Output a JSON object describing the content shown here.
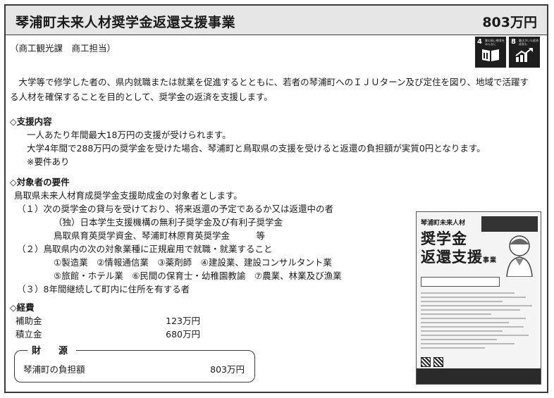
{
  "header": {
    "title": "琴浦町未来人材奨学金返還支援事業",
    "amount": "803万円"
  },
  "department": "（商工観光課　商工担当）",
  "sdgs": [
    {
      "num": "4",
      "caption": "質の高い教育をみんなに",
      "icon": "book-icon"
    },
    {
      "num": "8",
      "caption": "働きがいも経済成長も",
      "icon": "growth-chart-icon"
    }
  ],
  "intro": "大学等で修学した者の、県内就職または就業を促進するとともに、若者の琴浦町へのＩＪＵターン及び定住を図り、地域で活躍する人材を確保することを目的として、奨学金の返済を支援します。",
  "support": {
    "heading": "◇支援内容",
    "lines": [
      "一人あたり年間最大18万円の支援が受けられます。",
      "大学4年間で288万円の奨学金を受けた場合、琴浦町と鳥取県の支援を受けると返還の負担額が実質0円となります。",
      "※要件あり"
    ]
  },
  "eligibility": {
    "heading": "◇対象者の要件",
    "intro": "鳥取県未来人材育成奨学金支援助成金の対象者とします。",
    "item1": "（１）次の奨学金の貸与を受けており、将来返還の予定であるか又は返還中の者",
    "item1_sub1": "（独）日本学生支援機構の無利子奨学金及び有利子奨学金",
    "item1_sub2": "鳥取県育英奨学資金、琴浦町林原育英奨学金　　　等",
    "item2": "（２）鳥取県内の次の対象業種に正規雇用で就職・就業すること",
    "item2_sub1": "①製造業　②情報通信業　③薬剤師　④建設業、建設コンサルタント業",
    "item2_sub2": "⑤旅館・ホテル業　⑥民間の保育士・幼稚園教諭　⑦農業、林業及び漁業",
    "item3": "（３）8年間継続して町内に住所を有する者"
  },
  "expenses": {
    "heading": "◇経費",
    "rows": [
      {
        "label": "補助金",
        "value": "123万円"
      },
      {
        "label": "積立金",
        "value": "680万円"
      }
    ]
  },
  "funding": {
    "title": "財　源",
    "label": "琴浦町の負担額",
    "value": "803万円"
  },
  "leaflet": {
    "top": "琴浦町未来人材",
    "big1": "奨学金",
    "big2": "返還支援",
    "suffix": "事業"
  },
  "colors": {
    "header_bg": "#e6e6e6",
    "border": "#3a3a3a",
    "sdg_tile": "#1e1e1e"
  }
}
